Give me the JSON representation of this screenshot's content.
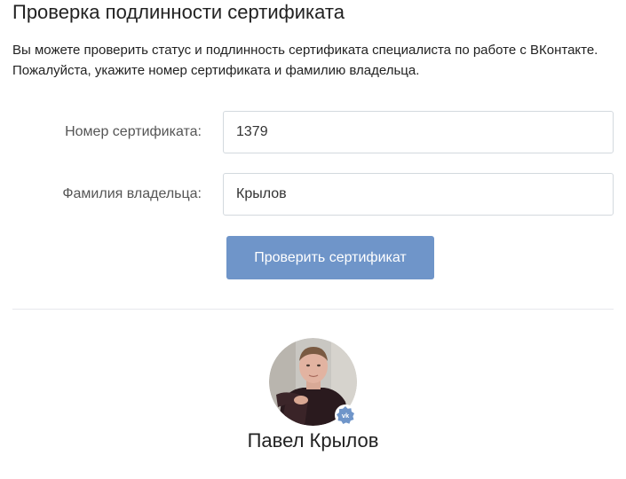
{
  "page": {
    "title": "Проверка подлинности сертификата",
    "intro": "Вы можете проверить статус и подлинность сертификата специалиста по работе с ВКонтакте. Пожалуйста, укажите номер сертификата и фамилию владельца."
  },
  "form": {
    "certificate_number": {
      "label": "Номер сертификата:",
      "value": "1379"
    },
    "owner_surname": {
      "label": "Фамилия владельца:",
      "value": "Крылов"
    },
    "submit_label": "Проверить сертификат"
  },
  "result": {
    "owner_name": "Павел Крылов",
    "badge_icon": "vk-verified-badge-icon"
  },
  "colors": {
    "button": "#6f95c9",
    "divider": "#e7e8ec",
    "input_border": "#d3d9de",
    "badge": "#6f95c9"
  }
}
